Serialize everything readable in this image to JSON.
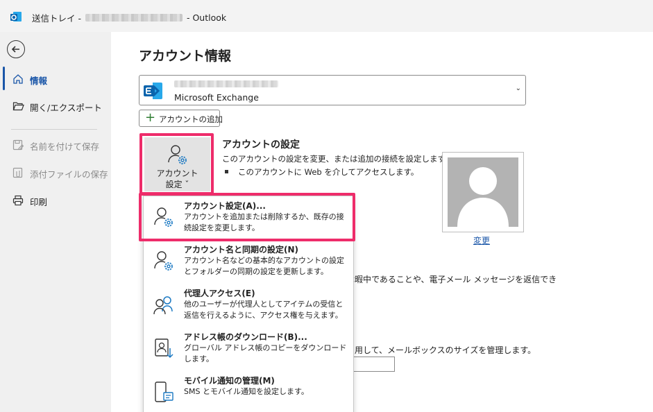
{
  "titlebar": {
    "prefix": "送信トレイ -",
    "suffix": "-  Outlook"
  },
  "nav": {
    "items": [
      {
        "label": "情報",
        "icon": "home-icon",
        "state": "active"
      },
      {
        "label": "開く/エクスポート",
        "icon": "folder-open-icon",
        "state": "normal"
      },
      {
        "label": "名前を付けて保存",
        "icon": "save-as-icon",
        "state": "disabled"
      },
      {
        "label": "添付ファイルの保存",
        "icon": "save-attachment-icon",
        "state": "disabled"
      },
      {
        "label": "印刷",
        "icon": "printer-icon",
        "state": "normal"
      }
    ]
  },
  "main": {
    "title": "アカウント情報",
    "account": {
      "type": "Microsoft Exchange"
    },
    "add_account_label": "アカウントの追加",
    "settings_button": {
      "line1": "アカウント",
      "line2": "設定 ˇ"
    },
    "settings_heading": "アカウントの設定",
    "settings_desc": "このアカウントの設定を変更、または追加の接続を設定します。",
    "settings_bullet": "このアカウントに Web を介してアクセスします。",
    "change_link": "変更",
    "bg_text1": "休暇中であることや、電子メール メッセージを返信でき",
    "bg_text2": "利用して、メールボックスのサイズを管理します。"
  },
  "menu": {
    "items": [
      {
        "title": "アカウント設定(A)...",
        "desc": "アカウントを追加または削除するか、既存の接続設定を変更します。",
        "icon": "account-settings-icon"
      },
      {
        "title": "アカウント名と同期の設定(N)",
        "desc": "アカウント名などの基本的なアカウントの設定とフォルダーの同期の設定を更新します。",
        "icon": "account-sync-icon"
      },
      {
        "title": "代理人アクセス(E)",
        "desc": "他のユーザーが代理人としてアイテムの受信と返信を行えるように、アクセス権を与えます。",
        "icon": "delegate-access-icon"
      },
      {
        "title": "アドレス帳のダウンロード(B)...",
        "desc": "グローバル アドレス帳のコピーをダウンロードします。",
        "icon": "address-book-download-icon"
      },
      {
        "title": "モバイル通知の管理(M)",
        "desc": "SMS とモバイル通知を設定します。",
        "icon": "mobile-notification-icon"
      }
    ]
  },
  "colors": {
    "accent": "#1a56a8",
    "highlight": "#ee2c6a",
    "exchange_blue": "#0a64ad"
  }
}
